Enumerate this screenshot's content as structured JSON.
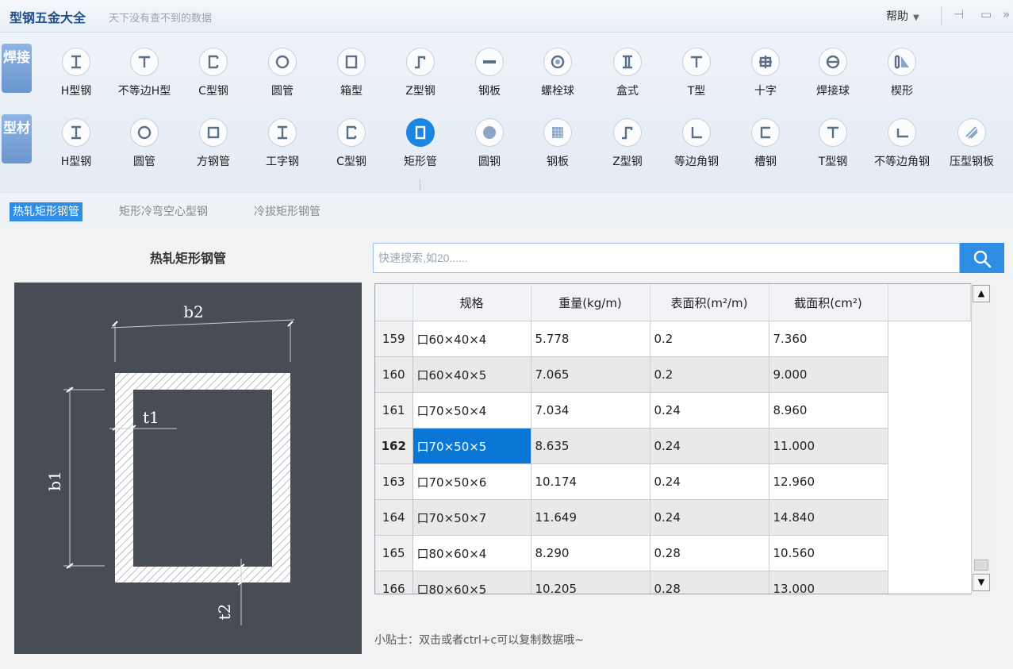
{
  "app": {
    "title": "型钢五金大全",
    "subtitle": "天下没有查不到的数据",
    "help": "帮助"
  },
  "toolbar": {
    "weld_tag": "焊接",
    "profile_tag": "型材",
    "weld_items": [
      {
        "label": "H型钢",
        "icon": "i-beam-icon"
      },
      {
        "label": "不等边H型",
        "icon": "t-section-icon"
      },
      {
        "label": "C型钢",
        "icon": "c-channel-icon"
      },
      {
        "label": "圆管",
        "icon": "round-pipe-icon"
      },
      {
        "label": "箱型",
        "icon": "box-section-icon"
      },
      {
        "label": "Z型钢",
        "icon": "z-section-icon"
      },
      {
        "label": "钢板",
        "icon": "plate-icon"
      },
      {
        "label": "螺栓球",
        "icon": "bolt-ball-icon"
      },
      {
        "label": "盒式",
        "icon": "box-type-icon"
      },
      {
        "label": "T型",
        "icon": "t-section-icon"
      },
      {
        "label": "十字",
        "icon": "cross-section-icon"
      },
      {
        "label": "焊接球",
        "icon": "weld-ball-icon"
      },
      {
        "label": "楔形",
        "icon": "wedge-icon"
      }
    ],
    "profile_items": [
      {
        "label": "H型钢",
        "icon": "i-beam-icon"
      },
      {
        "label": "圆管",
        "icon": "round-pipe-icon"
      },
      {
        "label": "方钢管",
        "icon": "square-tube-icon"
      },
      {
        "label": "工字钢",
        "icon": "i-beam-icon"
      },
      {
        "label": "C型钢",
        "icon": "c-channel-icon"
      },
      {
        "label": "矩形管",
        "icon": "rect-tube-icon",
        "active": true
      },
      {
        "label": "圆钢",
        "icon": "round-bar-icon"
      },
      {
        "label": "钢板",
        "icon": "checker-plate-icon"
      },
      {
        "label": "Z型钢",
        "icon": "z-section-icon"
      },
      {
        "label": "等边角钢",
        "icon": "equal-angle-icon"
      },
      {
        "label": "槽钢",
        "icon": "channel-icon"
      },
      {
        "label": "T型钢",
        "icon": "t-section-icon"
      },
      {
        "label": "不等边角钢",
        "icon": "unequal-angle-icon"
      },
      {
        "label": "压型钢板",
        "icon": "deck-sheet-icon"
      }
    ]
  },
  "subtabs": [
    {
      "label": "热轧矩形钢管",
      "active": true
    },
    {
      "label": "矩形冷弯空心型钢"
    },
    {
      "label": "冷拔矩形钢管"
    }
  ],
  "section_title": "热轧矩形钢管",
  "diagram": {
    "b2": "b2",
    "b1": "b1",
    "t1": "t1",
    "t2": "t2"
  },
  "search": {
    "placeholder": "快速搜索,如20......"
  },
  "table": {
    "columns": [
      "规格",
      "重量(kg/m)",
      "表面积(m²/m)",
      "截面积(cm²)"
    ],
    "rows": [
      {
        "no": "159",
        "spec": "口60×40×4",
        "weight": "5.778",
        "surface": "0.2",
        "area": "7.360"
      },
      {
        "no": "160",
        "spec": "口60×40×5",
        "weight": "7.065",
        "surface": "0.2",
        "area": "9.000"
      },
      {
        "no": "161",
        "spec": "口70×50×4",
        "weight": "7.034",
        "surface": "0.24",
        "area": "8.960"
      },
      {
        "no": "162",
        "spec": "口70×50×5",
        "weight": "8.635",
        "surface": "0.24",
        "area": "11.000",
        "selected": true
      },
      {
        "no": "163",
        "spec": "口70×50×6",
        "weight": "10.174",
        "surface": "0.24",
        "area": "12.960"
      },
      {
        "no": "164",
        "spec": "口70×50×7",
        "weight": "11.649",
        "surface": "0.24",
        "area": "14.840"
      },
      {
        "no": "165",
        "spec": "口80×60×4",
        "weight": "8.290",
        "surface": "0.28",
        "area": "10.560"
      },
      {
        "no": "166",
        "spec": "口80×60×5",
        "weight": "10.205",
        "surface": "0.28",
        "area": "13.000"
      }
    ]
  },
  "tip": "小贴士：双击或者ctrl+c可以复制数据哦~",
  "colors": {
    "accent": "#2f8ee3",
    "selection": "#0a77d6",
    "diagram_bg": "#484c55"
  }
}
